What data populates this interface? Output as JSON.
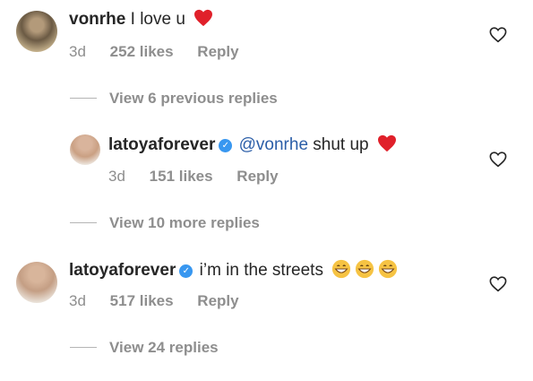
{
  "comments": [
    {
      "username": "vonrhe",
      "text": "I love u",
      "time": "3d",
      "likes": "252 likes",
      "reply": "Reply"
    },
    {
      "username": "latoyaforever",
      "mention": "@vonrhe",
      "text": "shut up",
      "time": "3d",
      "likes": "151 likes",
      "reply": "Reply"
    },
    {
      "username": "latoyaforever",
      "text": "i’m in the streets",
      "time": "3d",
      "likes": "517 likes",
      "reply": "Reply"
    }
  ],
  "threads": {
    "view_previous": "View 6 previous replies",
    "view_more": "View 10 more replies",
    "view_replies": "View 24 replies"
  },
  "icons": {
    "heart": "red-heart-emoji",
    "grin": "grinning-face-emoji",
    "like": "heart-outline-icon",
    "verified": "verified-badge-icon"
  },
  "colors": {
    "username": "#262626",
    "meta": "#8e8e8e",
    "mention": "#2b5ea8",
    "verified": "#3897f0",
    "heart": "#e0202a"
  }
}
